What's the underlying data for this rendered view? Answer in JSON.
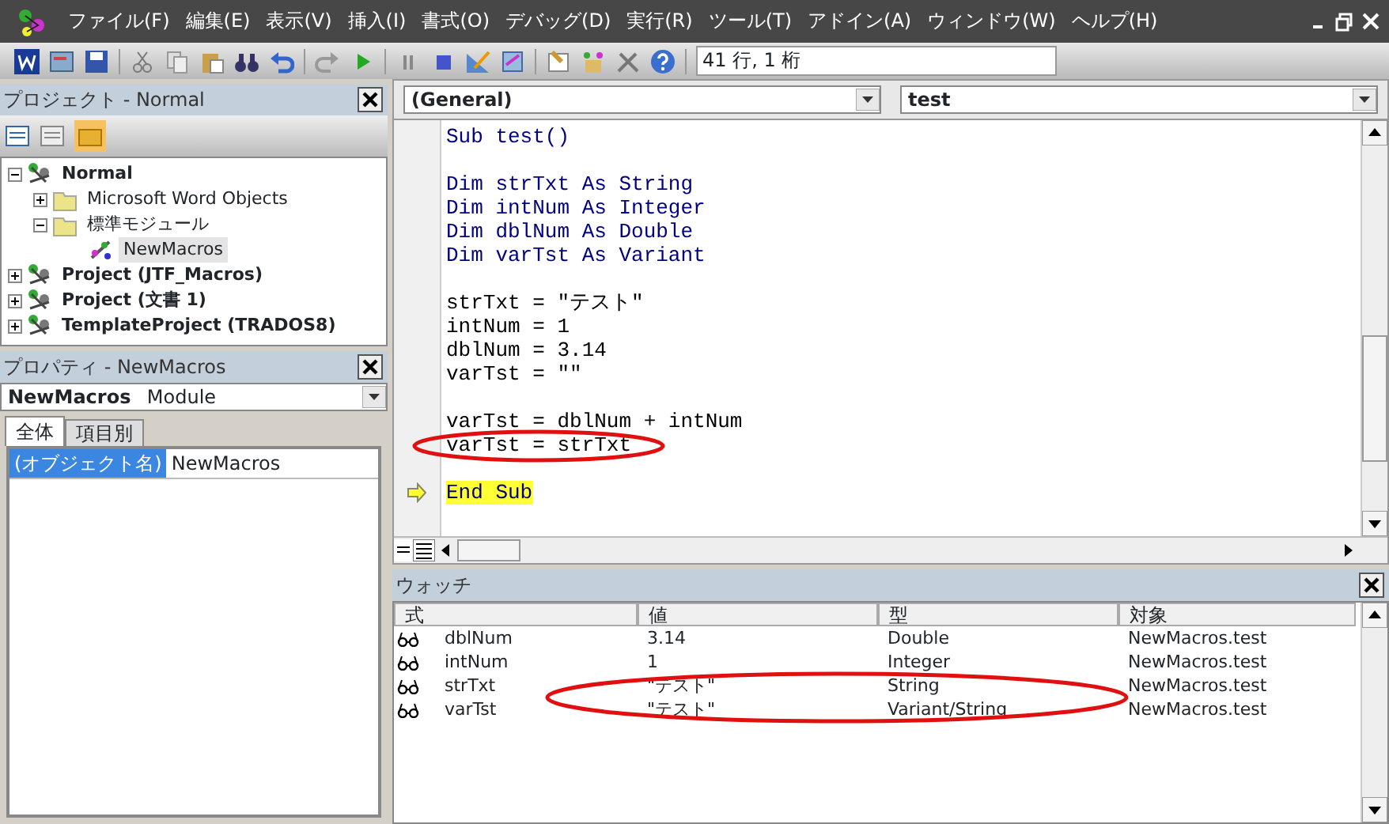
{
  "menu": [
    {
      "label": "ファイル(F)"
    },
    {
      "label": "編集(E)"
    },
    {
      "label": "表示(V)"
    },
    {
      "label": "挿入(I)"
    },
    {
      "label": "書式(O)"
    },
    {
      "label": "デバッグ(D)"
    },
    {
      "label": "実行(R)"
    },
    {
      "label": "ツール(T)"
    },
    {
      "label": "アドイン(A)"
    },
    {
      "label": "ウィンドウ(W)"
    },
    {
      "label": "ヘルプ(H)"
    }
  ],
  "toolbar": {
    "position": "41 行, 1 桁"
  },
  "project": {
    "title": "プロジェクト - Normal",
    "tree": [
      {
        "label": "Normal",
        "kind": "project",
        "expanded": true,
        "children": [
          {
            "label": "Microsoft Word Objects",
            "kind": "folder",
            "expanded": false
          },
          {
            "label": "標準モジュール",
            "kind": "folder",
            "expanded": true,
            "children": [
              {
                "label": "NewMacros",
                "kind": "module",
                "selected": true
              }
            ]
          }
        ]
      },
      {
        "label": "Project (JTF_Macros)",
        "kind": "project",
        "expanded": false
      },
      {
        "label": "Project (文書 1)",
        "kind": "project",
        "expanded": false
      },
      {
        "label": "TemplateProject (TRADOS8)",
        "kind": "project",
        "expanded": false
      }
    ]
  },
  "properties": {
    "title": "プロパティ - NewMacros",
    "object_name": "NewMacros",
    "object_type": "Module",
    "tabs": [
      {
        "label": "全体",
        "selected": true
      },
      {
        "label": "項目別",
        "selected": false
      }
    ],
    "rows": [
      {
        "name": "(オブジェクト名)",
        "value": "NewMacros",
        "selected": true
      }
    ]
  },
  "code": {
    "object": "(General)",
    "procedure": "test",
    "lines": [
      {
        "text": "Sub test()",
        "kind": "keyword",
        "current": false
      },
      {
        "kind": "blank",
        "current": false
      },
      {
        "text": "Dim strTxt As String",
        "kind": "keyword",
        "current": false
      },
      {
        "text": "Dim intNum As Integer",
        "kind": "keyword",
        "current": false
      },
      {
        "text": "Dim dblNum As Double",
        "kind": "keyword",
        "current": false
      },
      {
        "text": "Dim varTst As Variant",
        "kind": "keyword",
        "current": false
      },
      {
        "kind": "blank",
        "current": false
      },
      {
        "text": "strTxt = \"テスト\"",
        "kind": "plain",
        "current": false
      },
      {
        "text": "intNum = 1",
        "kind": "plain",
        "current": false
      },
      {
        "text": "dblNum = 3.14",
        "kind": "plain",
        "current": false
      },
      {
        "text": "varTst = \"\"",
        "kind": "plain",
        "current": false
      },
      {
        "kind": "blank",
        "current": false
      },
      {
        "text": "varTst = dblNum + intNum",
        "kind": "plain",
        "current": false
      },
      {
        "text": "varTst = strTxt",
        "kind": "plain",
        "current": false
      },
      {
        "kind": "blank",
        "current": false
      },
      {
        "text": "End Sub",
        "kind": "keyword",
        "current": true
      }
    ]
  },
  "watch": {
    "title": "ウォッチ",
    "columns": [
      "式",
      "値",
      "型",
      "対象"
    ],
    "rows": [
      {
        "expression": "dblNum",
        "value": "3.14",
        "type": "Double",
        "context": "NewMacros.test"
      },
      {
        "expression": "intNum",
        "value": "1",
        "type": "Integer",
        "context": "NewMacros.test"
      },
      {
        "expression": "strTxt",
        "value": "\"テスト\"",
        "type": "String",
        "context": "NewMacros.test"
      },
      {
        "expression": "varTst",
        "value": "\"テスト\"",
        "type": "Variant/String",
        "context": "NewMacros.test"
      }
    ]
  }
}
